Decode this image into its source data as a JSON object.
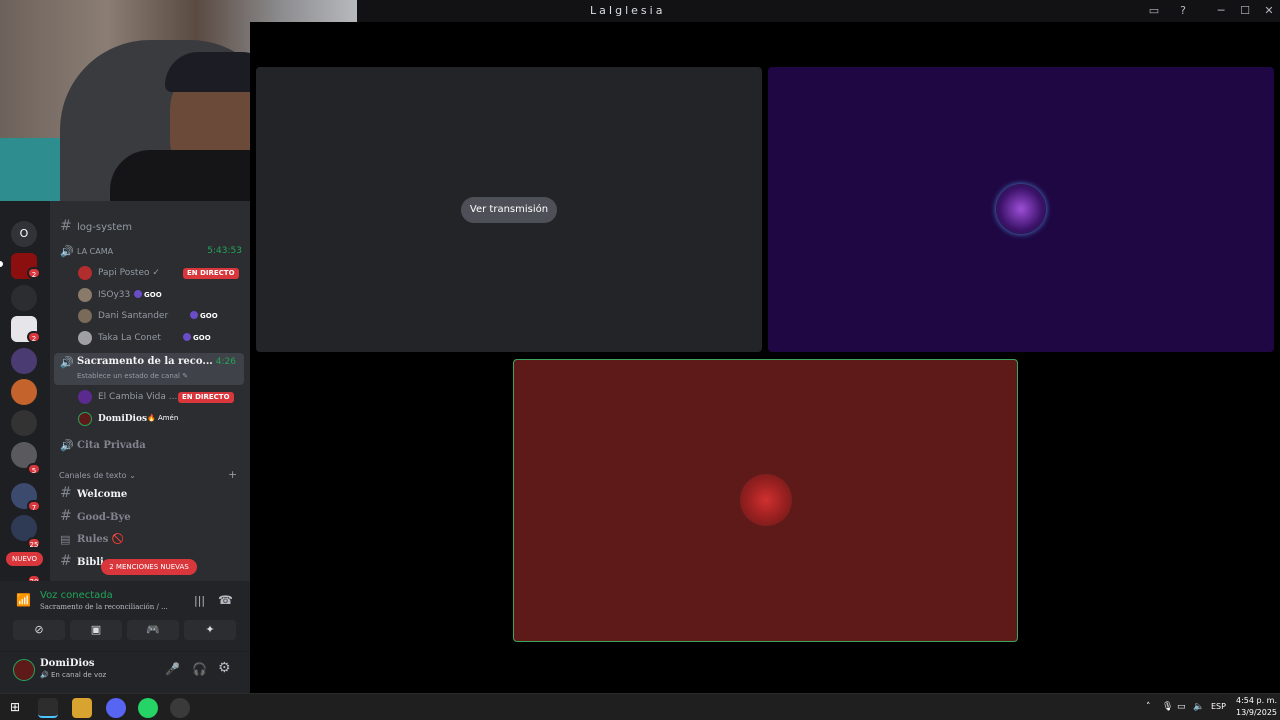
{
  "window": {
    "title": "LaIglesia",
    "inbox_icon": "inbox-icon",
    "help_icon": "help-icon",
    "minimize": "─",
    "maximize": "☐",
    "close": "✕"
  },
  "server_rail": {
    "home_letter": "O",
    "badges": [
      "2",
      "2",
      "5",
      "7",
      "25",
      "20"
    ],
    "new_label": "NUEVO"
  },
  "channels": {
    "log_system": "log-system",
    "voice_channel_1": {
      "name": "LA CAMA",
      "timer": "5:43:53"
    },
    "users_1": [
      {
        "name": "Papi Posteo ✓",
        "badge": "EN DIRECTO"
      },
      {
        "name": "ISOy33",
        "badge": "GOO"
      },
      {
        "name": "Dani Santander",
        "badge": "GOO"
      },
      {
        "name": "Taka La Conet",
        "badge": "GOO"
      }
    ],
    "voice_channel_2": {
      "name": "Sacramento de la reco...",
      "timer": "4:26",
      "status": "Establece un estado de canal ✎"
    },
    "users_2": [
      {
        "name": "El Cambia Vida ...",
        "badge": "EN DIRECTO"
      },
      {
        "name": "DomiDios",
        "badge": "🔥 Amén"
      }
    ],
    "voice_channel_3": "Cita Privada",
    "text_category": "Canales de texto ⌄",
    "add_icon": "+",
    "text_channels": [
      "Welcome",
      "Good-Bye",
      "Rules 🚫",
      "Bibli..."
    ],
    "mentions_label": "2 MENCIONES NUEVAS"
  },
  "voice": {
    "status": "Voz conectada",
    "channel": "Sacramento de la reconciliación / ...",
    "buttons": [
      "camera-off",
      "screen-share",
      "activities",
      "soundboard"
    ]
  },
  "user": {
    "name": "DomiDios",
    "status": "En canal de voz"
  },
  "stage": {
    "watch_label": "Ver transmisión"
  },
  "taskbar": {
    "lang": "ESP",
    "time": "4:54 p. m.",
    "date": "13/9/2025"
  },
  "colors": {
    "accent_green": "#23a559",
    "live_red": "#da373c",
    "tile_purple": "#1f0743",
    "tile_red": "#5e1a19"
  }
}
